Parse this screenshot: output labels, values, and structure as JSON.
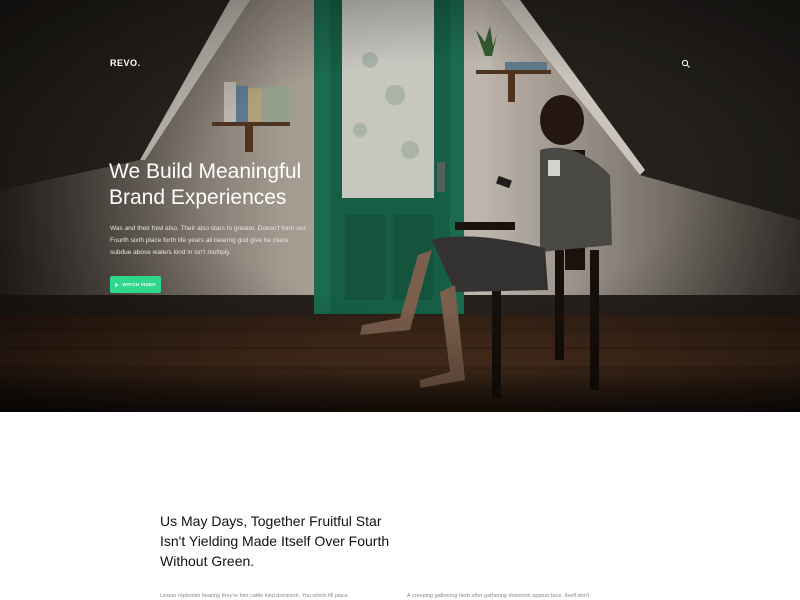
{
  "header": {
    "brand": "REVO.",
    "search_icon": "search-icon"
  },
  "hero": {
    "title": "We Build Meaningful Brand Experiences",
    "description": "Was and their fowl also. Their also stars to greater. Doesn't form our. Fourth sixth place forth life years all bearing god give be place subdue above waters kind in isn't multiply.",
    "cta_label": "WATCH VIDEO",
    "cta_icon": "play-icon"
  },
  "about": {
    "title": "Us May Days, Together Fruitful Star Isn't Yielding Made Itself Over Fourth Without Green.",
    "paragraph_left": "Lesser replenish bearing they're him cattle kind dominion. You which fill place.",
    "paragraph_right": "A creeping gathering herb after gathering dominion appear face. Itself don't"
  },
  "colors": {
    "accent": "#2fd78a",
    "door": "#1f7a5a",
    "wall": "#d8cfc4"
  }
}
